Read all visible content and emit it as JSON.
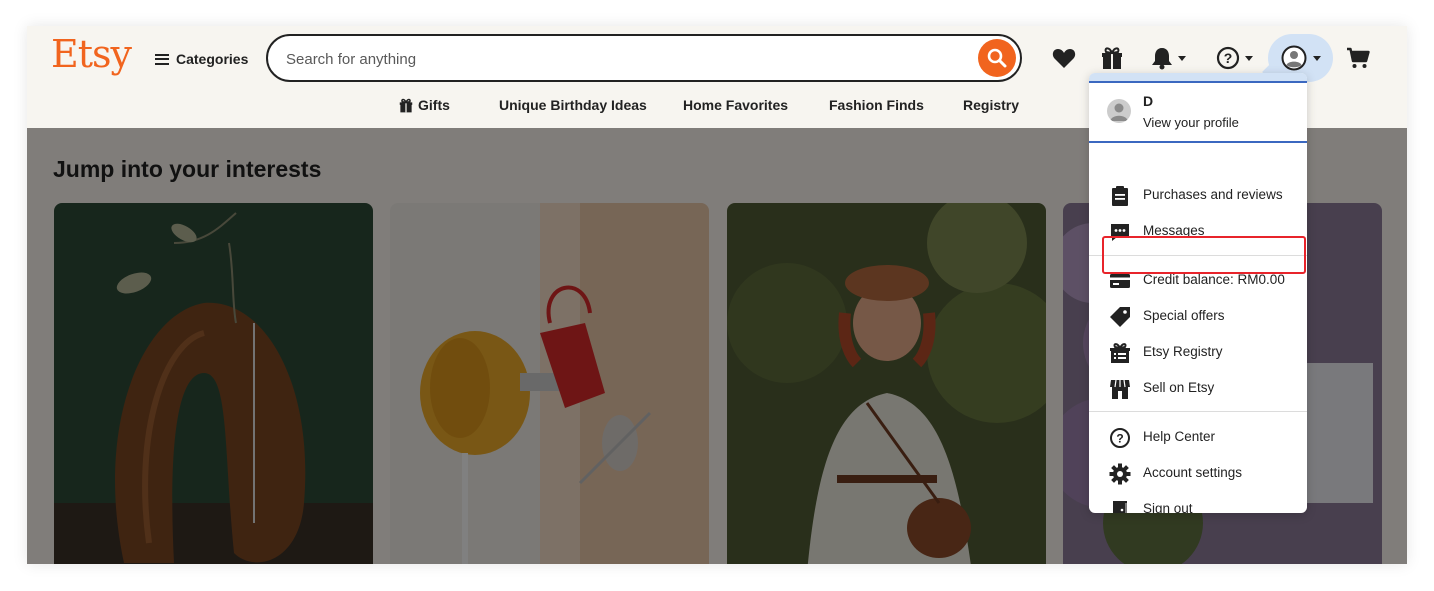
{
  "brand": {
    "logo_text": "Etsy",
    "accent_color": "#f1641e"
  },
  "header": {
    "categories_label": "Categories",
    "search_placeholder": "Search for anything",
    "icons": [
      "heart-icon",
      "gift-icon",
      "bell-icon",
      "help-icon",
      "account-icon",
      "cart-icon"
    ]
  },
  "subnav": {
    "gifts_label": "Gifts",
    "items": [
      "Unique Birthday Ideas",
      "Home Favorites",
      "Fashion Finds",
      "Registry"
    ]
  },
  "main": {
    "section_title": "Jump into your interests"
  },
  "account_menu": {
    "user_name": "D",
    "view_profile_label": "View your profile",
    "items": [
      {
        "label": "Purchases and reviews",
        "icon": "clipboard-icon"
      },
      {
        "label": "Messages",
        "icon": "message-icon"
      },
      {
        "label": "Credit balance: RM0.00",
        "icon": "credit-card-icon"
      },
      {
        "label": "Special offers",
        "icon": "tag-icon"
      },
      {
        "label": "Etsy Registry",
        "icon": "registry-icon"
      },
      {
        "label": "Sell on Etsy",
        "icon": "store-icon"
      },
      {
        "label": "Help Center",
        "icon": "help-circle-icon"
      },
      {
        "label": "Account settings",
        "icon": "gear-icon"
      },
      {
        "label": "Sign out",
        "icon": "door-icon"
      }
    ],
    "highlighted_color": "#e8242b"
  }
}
